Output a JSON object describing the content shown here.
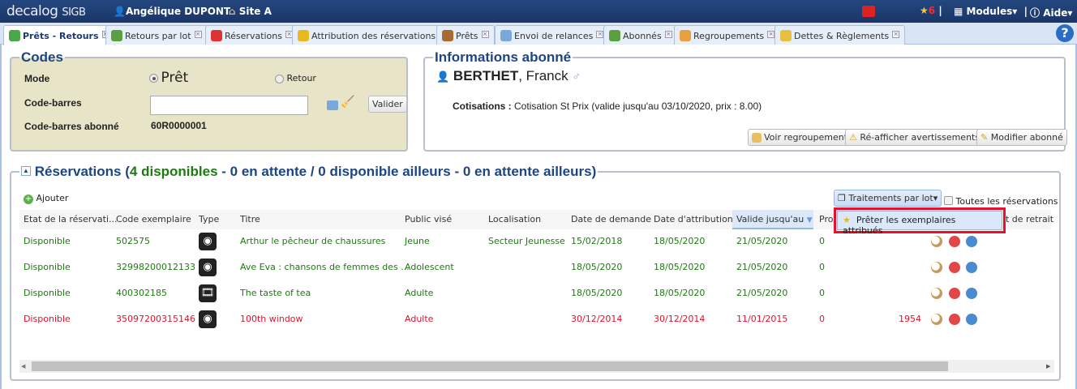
{
  "header": {
    "logo": "decalog",
    "logo_suffix": "SIGB",
    "user": "Angélique DUPONT",
    "site": "Site A",
    "notif_count": "6",
    "modules": "Modules",
    "help": "Aide",
    "separator": "|"
  },
  "tabs": [
    {
      "label": "Prêts - Retours",
      "active": true
    },
    {
      "label": "Retours par lot"
    },
    {
      "label": "Réservations"
    },
    {
      "label": "Attribution des réservations"
    },
    {
      "label": "Prêts"
    },
    {
      "label": "Envoi de relances"
    },
    {
      "label": "Abonnés"
    },
    {
      "label": "Regroupements"
    },
    {
      "label": "Dettes & Règlements"
    }
  ],
  "tab_close": "×",
  "help_icon": "?",
  "codes": {
    "title": "Codes",
    "mode_label": "Mode",
    "mode_pret": "Prêt",
    "mode_retour": "Retour",
    "mode_selected": "Prêt",
    "barcode_label": "Code-barres",
    "barcode_value": "",
    "validate": "Valider",
    "patron_barcode_label": "Code-barres abonné",
    "patron_barcode": "60R0000001"
  },
  "info": {
    "title": "Informations abonné",
    "last_name": "BERTHET",
    "first_name": ", Franck",
    "gender_symbol": "♂",
    "cotisations_label": "Cotisations :",
    "cotisations": "Cotisation St Prix (valide jusqu'au 03/10/2020, prix : 8.00)",
    "btn_regroupement": "Voir regroupement",
    "btn_avertissements": "Ré-afficher avertissements",
    "btn_modifier": "Modifier abonné"
  },
  "reservations": {
    "title_start": "Réservations (",
    "available": "4 disponibles",
    "title_end": " - 0 en attente / 0 disponible ailleurs - 0 en attente ailleurs)",
    "add": "Ajouter",
    "batch": "Traitements par lot",
    "all_label": "Toutes les réservations",
    "all_checked": false,
    "menu_item": "Prêter les exemplaires attribués",
    "columns": [
      "Etat de la réservati...",
      "Code exemplaire",
      "Type",
      "Titre",
      "Public visé",
      "Localisation",
      "Date de demande",
      "Date d'attribution",
      "Valide jusqu'au",
      "Pro",
      "t de retrait"
    ],
    "sorted_column": "Valide jusqu'au",
    "rows": [
      {
        "etat": "Disponible",
        "code": "502575",
        "type": "music-cd",
        "titre": "Arthur le pêcheur de chaussures",
        "public": "Jeune",
        "loc": "Secteur Jeunesse",
        "demande": "15/02/2018",
        "attribution": "18/05/2020",
        "valide": "21/05/2020",
        "pro": "0",
        "extra": "",
        "color": "green"
      },
      {
        "etat": "Disponible",
        "code": "32998200012133",
        "type": "music-cd",
        "titre": "Ave Eva : chansons de femmes des ...",
        "public": "Adolescent",
        "loc": "",
        "demande": "18/05/2020",
        "attribution": "18/05/2020",
        "valide": "21/05/2020",
        "pro": "0",
        "extra": "",
        "color": "green"
      },
      {
        "etat": "Disponible",
        "code": "400302185",
        "type": "film",
        "titre": "The taste of tea",
        "public": "Adulte",
        "loc": "",
        "demande": "18/05/2020",
        "attribution": "18/05/2020",
        "valide": "21/05/2020",
        "pro": "0",
        "extra": "",
        "color": "green"
      },
      {
        "etat": "Disponible",
        "code": "35097200315146",
        "type": "music-cd",
        "titre": "100th window",
        "public": "Adulte",
        "loc": "",
        "demande": "30/12/2014",
        "attribution": "30/12/2014",
        "valide": "11/01/2015",
        "pro": "0",
        "extra": "1954",
        "color": "red"
      }
    ]
  },
  "colors": {
    "header": "#1c3a6e",
    "green": "#1f7a12",
    "red": "#e8102a",
    "title": "#1d4584",
    "codes_bg": "#e7e4c7",
    "highlight": "#e8102a"
  }
}
